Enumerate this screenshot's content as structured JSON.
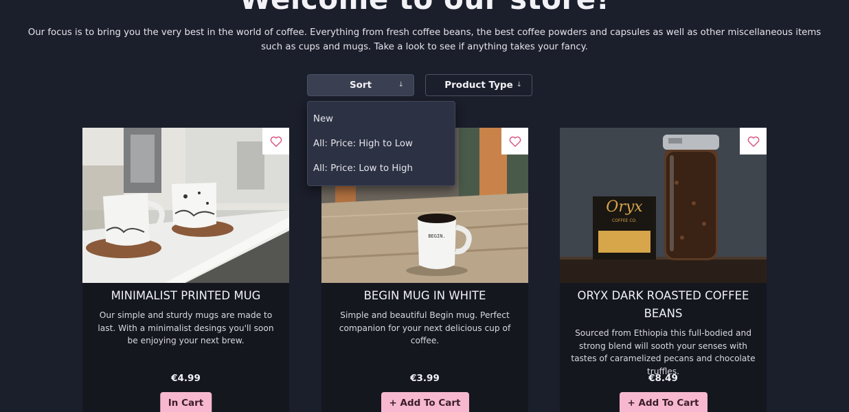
{
  "hero": {
    "title": "Welcome to our store!",
    "intro": "Our focus is to bring you the very best in the world of coffee. Everything from fresh coffee beans, the best coffee powders and capsules as well as other miscellaneous items such as cups and mugs. Take a look to see if anything takes your fancy."
  },
  "filters": {
    "sort_label": "Sort",
    "type_label": "Product Type",
    "sort_options": [
      "New",
      "All: Price: High to Low",
      "All: Price: Low to High"
    ]
  },
  "products": [
    {
      "name": "MINIMALIST PRINTED MUG",
      "description": "Our simple and sturdy mugs are made to last. With a minimalist desings you'll soon be enjoying your next brew.",
      "price": "€4.99",
      "cart_label": "In Cart"
    },
    {
      "name": "BEGIN MUG IN WHITE",
      "description": "Simple and beautiful Begin mug. Perfect companion for your next delicious cup of coffee.",
      "price": "€3.99",
      "cart_label": "+ Add To Cart",
      "mug_text": "BEGIN."
    },
    {
      "name": "ORYX DARK ROASTED COFFEE BEANS",
      "description": "Sourced from Ethiopia this full-bodied and strong blend will sooth your senses with tastes of caramelized pecans and chocolate truffles.",
      "price": "€8.49",
      "cart_label": "+ Add To Cart",
      "bag_brand": "Oryx",
      "bag_sub": "COFFEE CO."
    }
  ],
  "colors": {
    "background": "#1b1e2b",
    "card": "#15171f",
    "accent": "#f7b8cf",
    "heart": "#d9567f"
  }
}
